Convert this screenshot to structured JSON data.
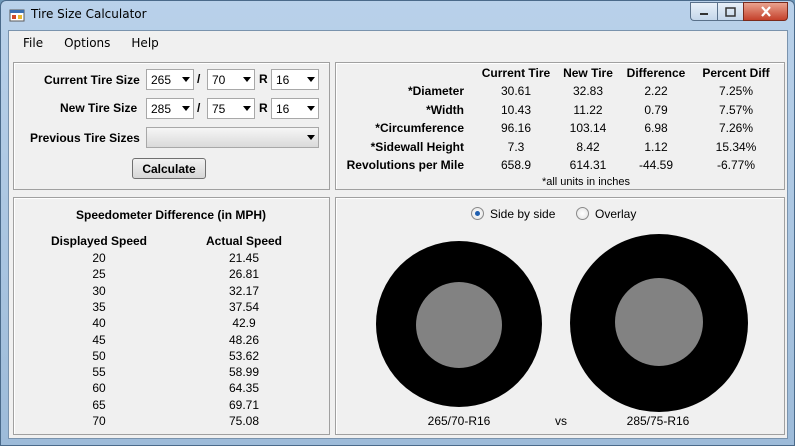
{
  "window": {
    "title": "Tire Size Calculator"
  },
  "menu": [
    "File",
    "Options",
    "Help"
  ],
  "input": {
    "current_label": "Current Tire Size",
    "new_label": "New Tire Size",
    "previous_label": "Previous Tire Sizes",
    "slash": "/",
    "r": "R",
    "current": {
      "width": "265",
      "aspect": "70",
      "rim": "16"
    },
    "new": {
      "width": "285",
      "aspect": "75",
      "rim": "16"
    },
    "previous_value": "",
    "calculate": "Calculate"
  },
  "results": {
    "headers": [
      "Current Tire",
      "New Tire",
      "Difference",
      "Percent Diff"
    ],
    "rows": [
      {
        "label": "*Diameter",
        "current": "30.61",
        "new": "32.83",
        "diff": "2.22",
        "pct": "7.25%"
      },
      {
        "label": "*Width",
        "current": "10.43",
        "new": "11.22",
        "diff": "0.79",
        "pct": "7.57%"
      },
      {
        "label": "*Circumference",
        "current": "96.16",
        "new": "103.14",
        "diff": "6.98",
        "pct": "7.26%"
      },
      {
        "label": "*Sidewall Height",
        "current": "7.3",
        "new": "8.42",
        "diff": "1.12",
        "pct": "15.34%"
      },
      {
        "label": "Revolutions per Mile",
        "current": "658.9",
        "new": "614.31",
        "diff": "-44.59",
        "pct": "-6.77%"
      }
    ],
    "note": "*all units in inches"
  },
  "speedo": {
    "title": "Speedometer Difference (in MPH)",
    "col1": "Displayed Speed",
    "col2": "Actual Speed",
    "rows": [
      {
        "displayed": "20",
        "actual": "21.45"
      },
      {
        "displayed": "25",
        "actual": "26.81"
      },
      {
        "displayed": "30",
        "actual": "32.17"
      },
      {
        "displayed": "35",
        "actual": "37.54"
      },
      {
        "displayed": "40",
        "actual": "42.9"
      },
      {
        "displayed": "45",
        "actual": "48.26"
      },
      {
        "displayed": "50",
        "actual": "53.62"
      },
      {
        "displayed": "55",
        "actual": "58.99"
      },
      {
        "displayed": "60",
        "actual": "64.35"
      },
      {
        "displayed": "65",
        "actual": "69.71"
      },
      {
        "displayed": "70",
        "actual": "75.08"
      }
    ]
  },
  "visual": {
    "side_by_side": "Side by side",
    "overlay": "Overlay",
    "selected": "side_by_side",
    "left_label": "265/70-R16",
    "vs": "vs",
    "right_label": "285/75-R16"
  },
  "colors": {
    "tire": "#000000",
    "rim": "#828282",
    "radio_dot": "#1f5fb0"
  }
}
